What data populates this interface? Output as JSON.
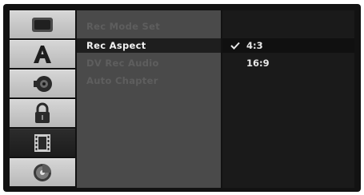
{
  "icons": [
    {
      "name": "tv-screen-icon",
      "selected": false
    },
    {
      "name": "font-a-icon",
      "selected": false
    },
    {
      "name": "speaker-icon",
      "selected": false
    },
    {
      "name": "padlock-icon",
      "selected": false
    },
    {
      "name": "film-strip-icon",
      "selected": true
    },
    {
      "name": "disc-icon",
      "selected": false
    }
  ],
  "menu": {
    "items": [
      {
        "label": "Rec Mode Set",
        "active": false
      },
      {
        "label": "Rec Aspect",
        "active": true
      },
      {
        "label": "DV Rec Audio",
        "active": false
      },
      {
        "label": "Auto Chapter",
        "active": false
      }
    ]
  },
  "options": {
    "items": [
      {
        "label": "4:3",
        "selected": true
      },
      {
        "label": "16:9",
        "selected": false
      }
    ],
    "check_icon": "checkmark-icon"
  },
  "colors": {
    "screen_bg": "#121212",
    "icon_tile": "#c8c8c8",
    "icon_tile_selected": "#242424",
    "menu_panel": "#4a4a4a",
    "menu_highlight": "#1e1e1e",
    "option_panel": "#1a1a1a"
  }
}
